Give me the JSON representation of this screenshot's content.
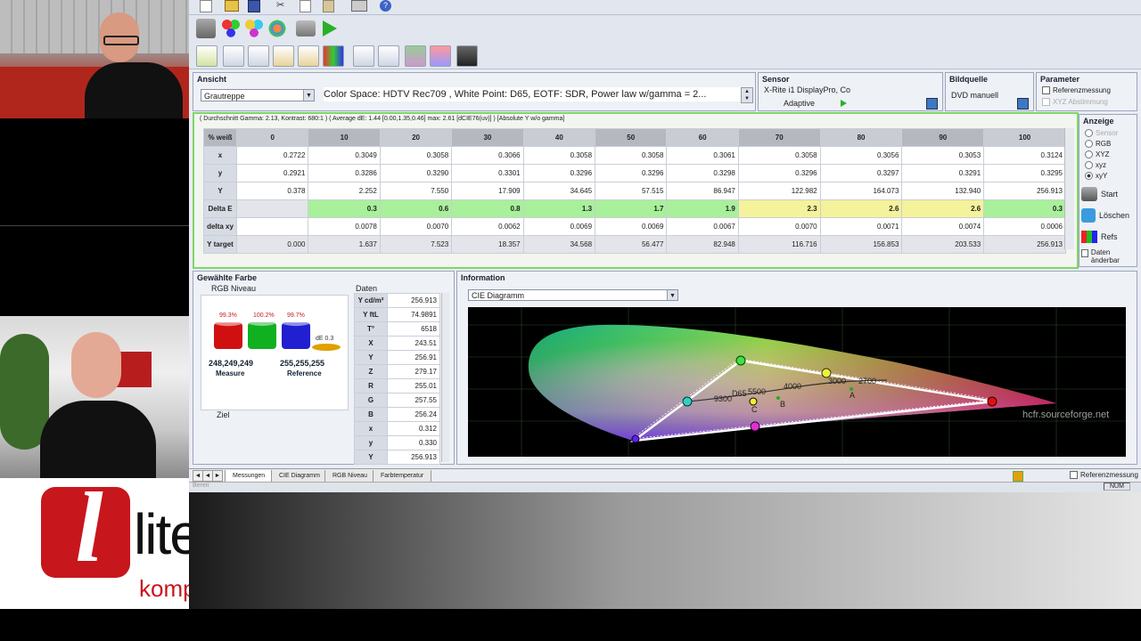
{
  "brand": {
    "logo_letter": "l",
    "logo_name": "lite",
    "logo_sub": "kompakt."
  },
  "toolbar": {
    "buttons": [
      "new",
      "open",
      "save",
      "cut",
      "copy",
      "paste",
      "print",
      "help"
    ]
  },
  "ansicht": {
    "title": "Ansicht",
    "select": "Grautreppe",
    "color_space_text": "Color Space: HDTV Rec709 , White Point: D65, EOTF:  SDR, Power law w/gamma = 2..."
  },
  "sensor": {
    "title": "Sensor",
    "device": "X-Rite i1 DisplayPro, Co",
    "mode": "Adaptive"
  },
  "bildquelle": {
    "title": "Bildquelle",
    "value": "DVD manuell"
  },
  "parameter": {
    "title": "Parameter",
    "opt1": "Referenzmessung",
    "opt2": "XYZ Abstimmung"
  },
  "summary": "( Durchschnitt Gamma: 2.13, Kontrast: 680:1 ) ( Average dE: 1.44 [0.00,1.35,0.46] max: 2.61 [dCIE76(uv)] ) [Absolute Y w/o gamma]",
  "meas_table": {
    "header_label": "% weiß",
    "columns": [
      "0",
      "10",
      "20",
      "30",
      "40",
      "50",
      "60",
      "70",
      "80",
      "90",
      "100"
    ],
    "rows": [
      {
        "label": "x",
        "cells": [
          "0.2722",
          "0.3049",
          "0.3058",
          "0.3066",
          "0.3058",
          "0.3058",
          "0.3061",
          "0.3058",
          "0.3056",
          "0.3053",
          "0.3124"
        ],
        "style": [
          "",
          "",
          "",
          "",
          "",
          "",
          "",
          "",
          "",
          "",
          ""
        ]
      },
      {
        "label": "y",
        "cells": [
          "0.2921",
          "0.3286",
          "0.3290",
          "0.3301",
          "0.3296",
          "0.3296",
          "0.3298",
          "0.3296",
          "0.3297",
          "0.3291",
          "0.3295"
        ],
        "style": [
          "",
          "",
          "",
          "",
          "",
          "",
          "",
          "",
          "",
          "",
          ""
        ]
      },
      {
        "label": "Y",
        "cells": [
          "0.378",
          "2.252",
          "7.550",
          "17.909",
          "34.645",
          "57.515",
          "86.947",
          "122.982",
          "164.073",
          "132.940",
          "256.913"
        ],
        "style": [
          "",
          "",
          "",
          "",
          "",
          "",
          "",
          "",
          "",
          "",
          ""
        ]
      },
      {
        "label": "Delta E",
        "cells": [
          "",
          "0.3",
          "0.6",
          "0.8",
          "1.3",
          "1.7",
          "1.9",
          "2.3",
          "2.6",
          "2.6",
          "0.3"
        ],
        "style": [
          "gray",
          "g",
          "g",
          "g",
          "g",
          "g",
          "g",
          "y",
          "y",
          "y",
          "g"
        ]
      },
      {
        "label": "delta xy",
        "cells": [
          "",
          "0.0078",
          "0.0070",
          "0.0062",
          "0.0069",
          "0.0069",
          "0.0067",
          "0.0070",
          "0.0071",
          "0.0074",
          "0.0006"
        ],
        "style": [
          "",
          "",
          "",
          "",
          "",
          "",
          "",
          "",
          "",
          "",
          ""
        ]
      },
      {
        "label": "Y target",
        "cells": [
          "0.000",
          "1.637",
          "7.523",
          "18.357",
          "34.568",
          "56.477",
          "82.948",
          "116.716",
          "156.853",
          "203.533",
          "256.913"
        ],
        "style": [
          "gray",
          "gray",
          "gray",
          "gray",
          "gray",
          "gray",
          "gray",
          "gray",
          "gray",
          "gray",
          "gray"
        ]
      }
    ]
  },
  "anzeige": {
    "title": "Anzeige",
    "options": [
      "Sensor",
      "RGB",
      "XYZ",
      "xyz",
      "xyY"
    ],
    "selected": "xyY"
  },
  "side_buttons": {
    "start": "Start",
    "loeschen": "Löschen",
    "refs": "Refs",
    "daten": "Daten änderbar"
  },
  "gewaehlte": {
    "title": "Gewählte Farbe",
    "rgb_label": "RGB Niveau",
    "bars": [
      {
        "label": "99.3%",
        "color": "#d01010",
        "fill": 0.993
      },
      {
        "label": "100.2%",
        "color": "#10b020",
        "fill": 1.002
      },
      {
        "label": "99.7%",
        "color": "#2020d0",
        "fill": 0.997
      }
    ],
    "de_label": "dE 0.3",
    "measure_values": "248,249,249",
    "measure_label": "Measure",
    "reference_values": "255,255,255",
    "reference_label": "Reference",
    "ziel": "Ziel"
  },
  "daten": {
    "title": "Daten",
    "rows": [
      {
        "k": "Y cd/m²",
        "v": "256.913"
      },
      {
        "k": "Y ftL",
        "v": "74.9891"
      },
      {
        "k": "T°",
        "v": "6518"
      },
      {
        "k": "X",
        "v": "243.51"
      },
      {
        "k": "Y",
        "v": "256.91"
      },
      {
        "k": "Z",
        "v": "279.17"
      },
      {
        "k": "R",
        "v": "255.01"
      },
      {
        "k": "G",
        "v": "257.55"
      },
      {
        "k": "B",
        "v": "256.24"
      },
      {
        "k": "x",
        "v": "0.312"
      },
      {
        "k": "y",
        "v": "0.330"
      },
      {
        "k": "Y",
        "v": "256.913"
      }
    ]
  },
  "information": {
    "title": "Information",
    "select": "CIE Diagramm",
    "labels": {
      "d65": "D65",
      "t5500": "5500",
      "t9300": "9300",
      "t4000": "4000",
      "t3000": "3000",
      "t2700": "2700",
      "a": "A",
      "b": "B",
      "c": "C",
      "watermark": "hcfr.sourceforge.net"
    }
  },
  "tabs": [
    "Messungen",
    "CIE Diagramm",
    "RGB Niveau",
    "Farbtemperatur"
  ],
  "status": {
    "referenz": "Referenzmessung",
    "num": "NUM",
    "bereit": "Bereit"
  }
}
